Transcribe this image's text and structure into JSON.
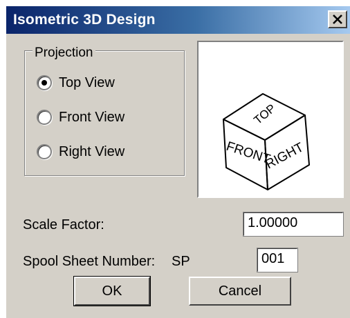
{
  "window": {
    "title": "Isometric 3D Design",
    "close_symbol": "✕"
  },
  "projection": {
    "group_label": "Projection",
    "options": [
      {
        "label": "Top View",
        "selected": true
      },
      {
        "label": "Front View",
        "selected": false
      },
      {
        "label": "Right View",
        "selected": false
      }
    ]
  },
  "preview": {
    "icon": "isometric-cube-icon",
    "top_text": "TOP",
    "front_text": "FRONT",
    "right_text": "RIGHT"
  },
  "scale_factor": {
    "label": "Scale Factor:",
    "value": "1.00000"
  },
  "spool_sheet": {
    "label": "Spool Sheet Number:",
    "prefix": "SP",
    "value": "001"
  },
  "buttons": {
    "ok": "OK",
    "cancel": "Cancel"
  },
  "colors": {
    "title_gradient_start": "#0a246a",
    "title_gradient_end": "#a6caf0",
    "dialog_face": "#d4d0c8"
  }
}
